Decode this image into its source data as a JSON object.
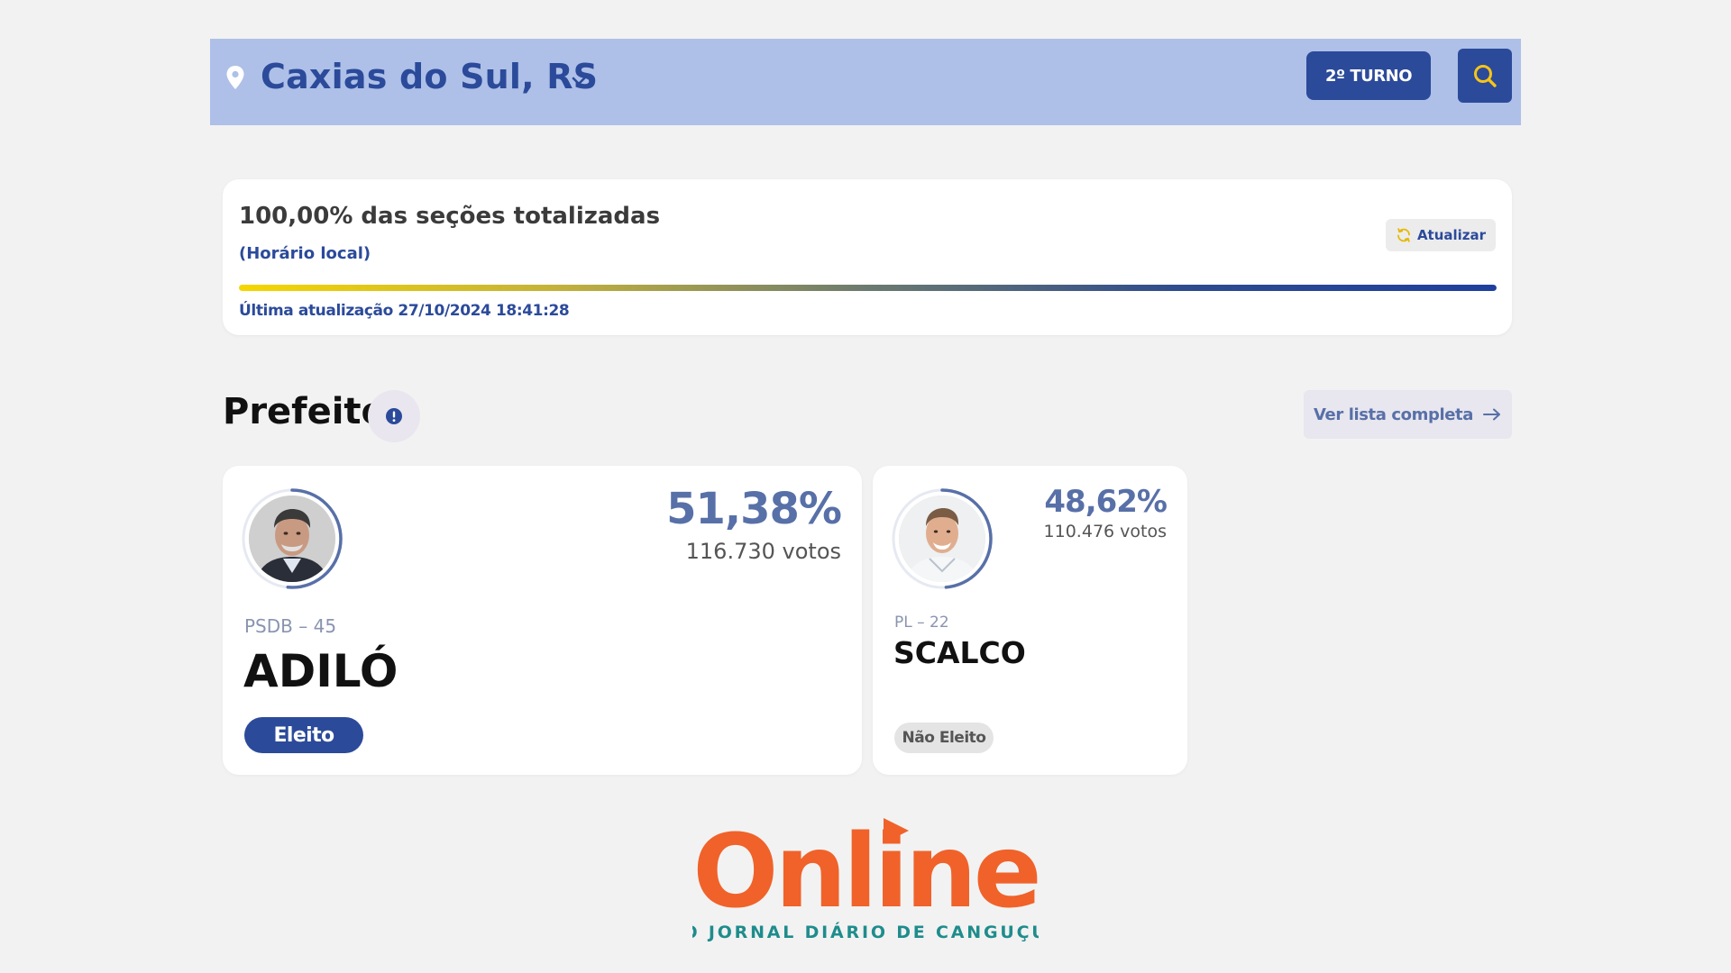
{
  "header": {
    "city": "Caxias do Sul, RS",
    "turno_label": "2º TURNO"
  },
  "status": {
    "title": "100,00% das seções totalizadas",
    "subtitle": "(Horário local)",
    "update_label": "Atualizar",
    "progress_percent": 100,
    "last_update": "Última atualização 27/10/2024 18:41:28"
  },
  "section": {
    "title": "Prefeito",
    "full_list_label": "Ver lista completa"
  },
  "candidates": [
    {
      "party": "PSDB – 45",
      "name": "ADILÓ",
      "percent": "51,38%",
      "votes": "116.730 votos",
      "status": "Eleito"
    },
    {
      "party": "PL – 22",
      "name": "SCALCO",
      "percent": "48,62%",
      "votes": "110.476 votos",
      "status": "Não Eleito"
    }
  ],
  "logo": {
    "wordmark": "Online",
    "tagline": "O JORNAL DIÁRIO DE CANGUÇU"
  },
  "colors": {
    "primary": "#2b4a9a",
    "header_bg": "#aec0e8",
    "accent_percent": "#5870a8",
    "logo_orange": "#f0622a",
    "logo_teal": "#1f8c8c",
    "search_icon": "#f5c518"
  }
}
